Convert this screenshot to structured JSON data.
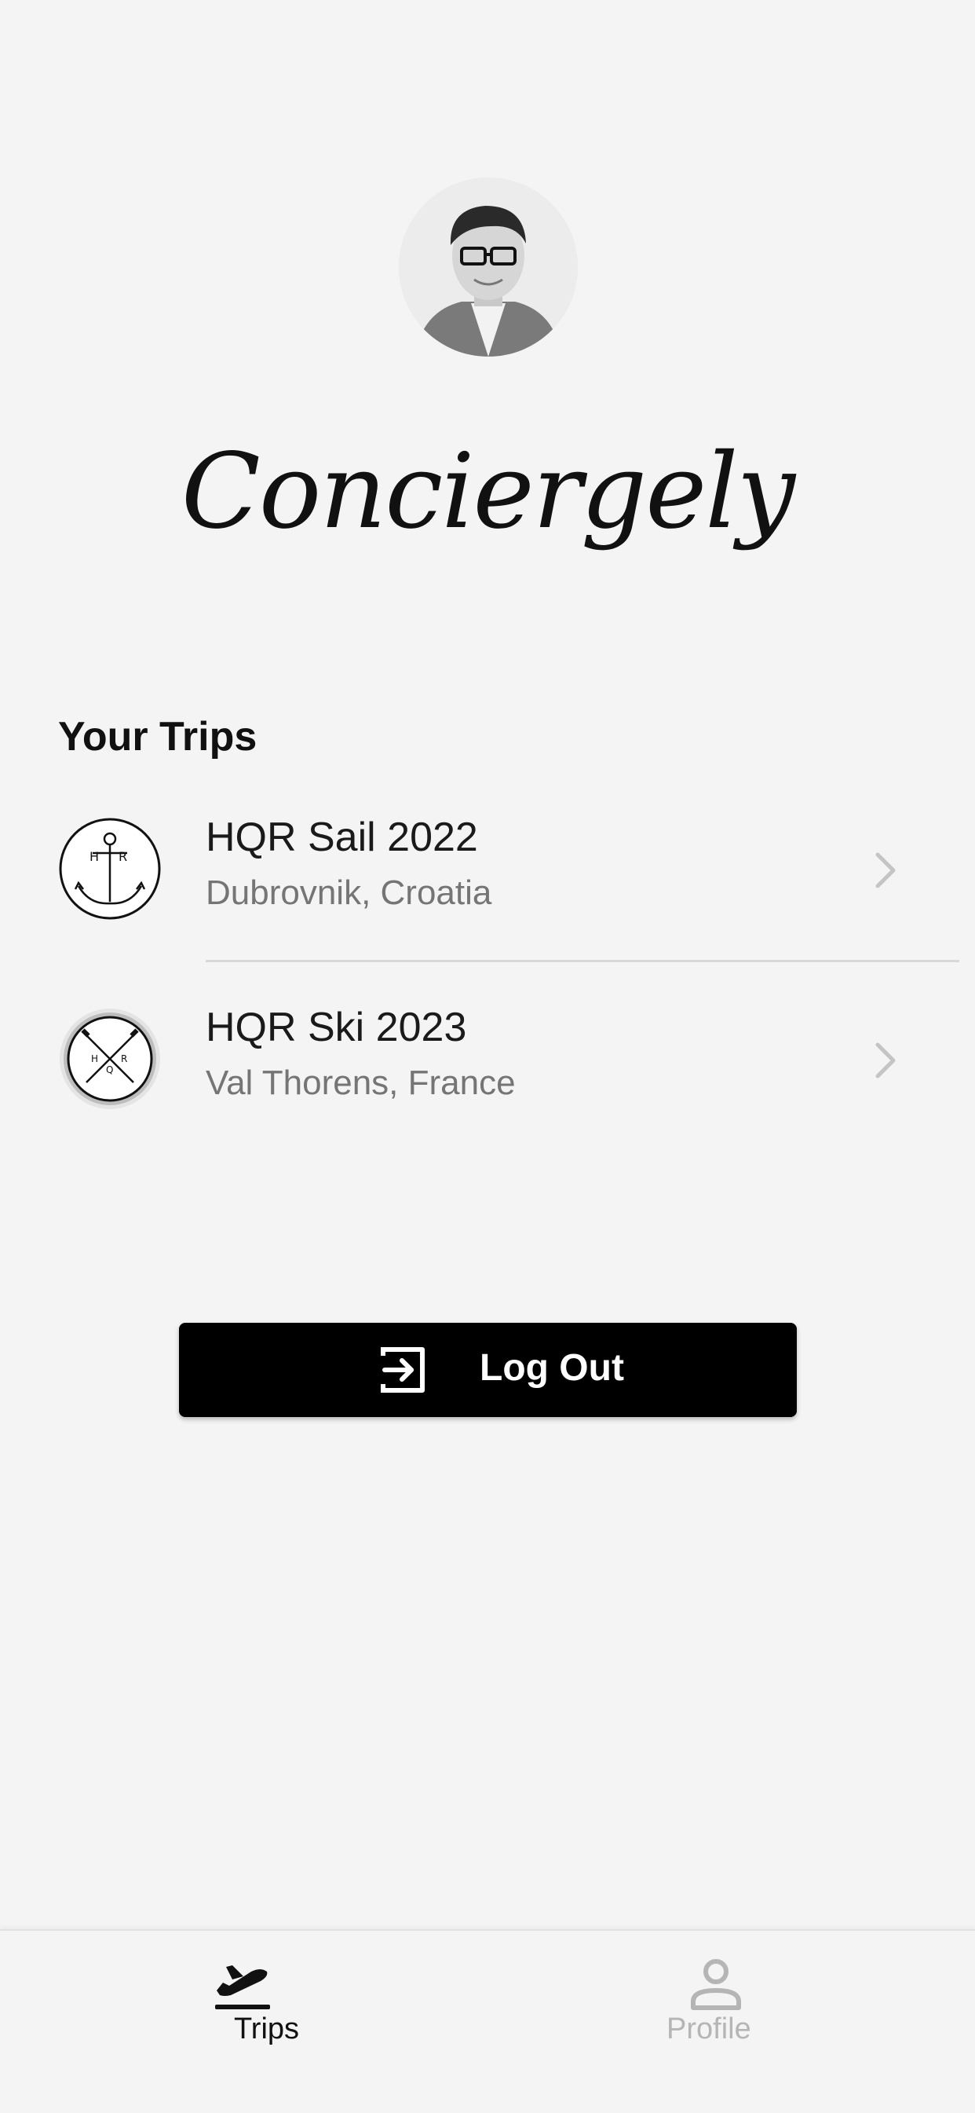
{
  "profile": {
    "avatar_icon": "user-photo"
  },
  "brand": {
    "name": "Conciergely"
  },
  "trips_section": {
    "title": "Your Trips",
    "items": [
      {
        "name": "HQR Sail 2022",
        "location": "Dubrovnik, Croatia",
        "logo_icon": "anchor-icon"
      },
      {
        "name": "HQR Ski 2023",
        "location": "Val Thorens, France",
        "logo_icon": "crossed-skis-icon"
      }
    ]
  },
  "logout": {
    "label": "Log Out",
    "icon": "logout-icon"
  },
  "tab_bar": {
    "tabs": [
      {
        "label": "Trips",
        "icon": "plane-departure-icon",
        "active": true
      },
      {
        "label": "Profile",
        "icon": "person-icon",
        "active": false
      }
    ]
  },
  "colors": {
    "background": "#f4f4f4",
    "primary_text": "#111111",
    "secondary_text": "#757575",
    "button_bg": "#000000",
    "inactive_tab": "#b5b5b5"
  }
}
